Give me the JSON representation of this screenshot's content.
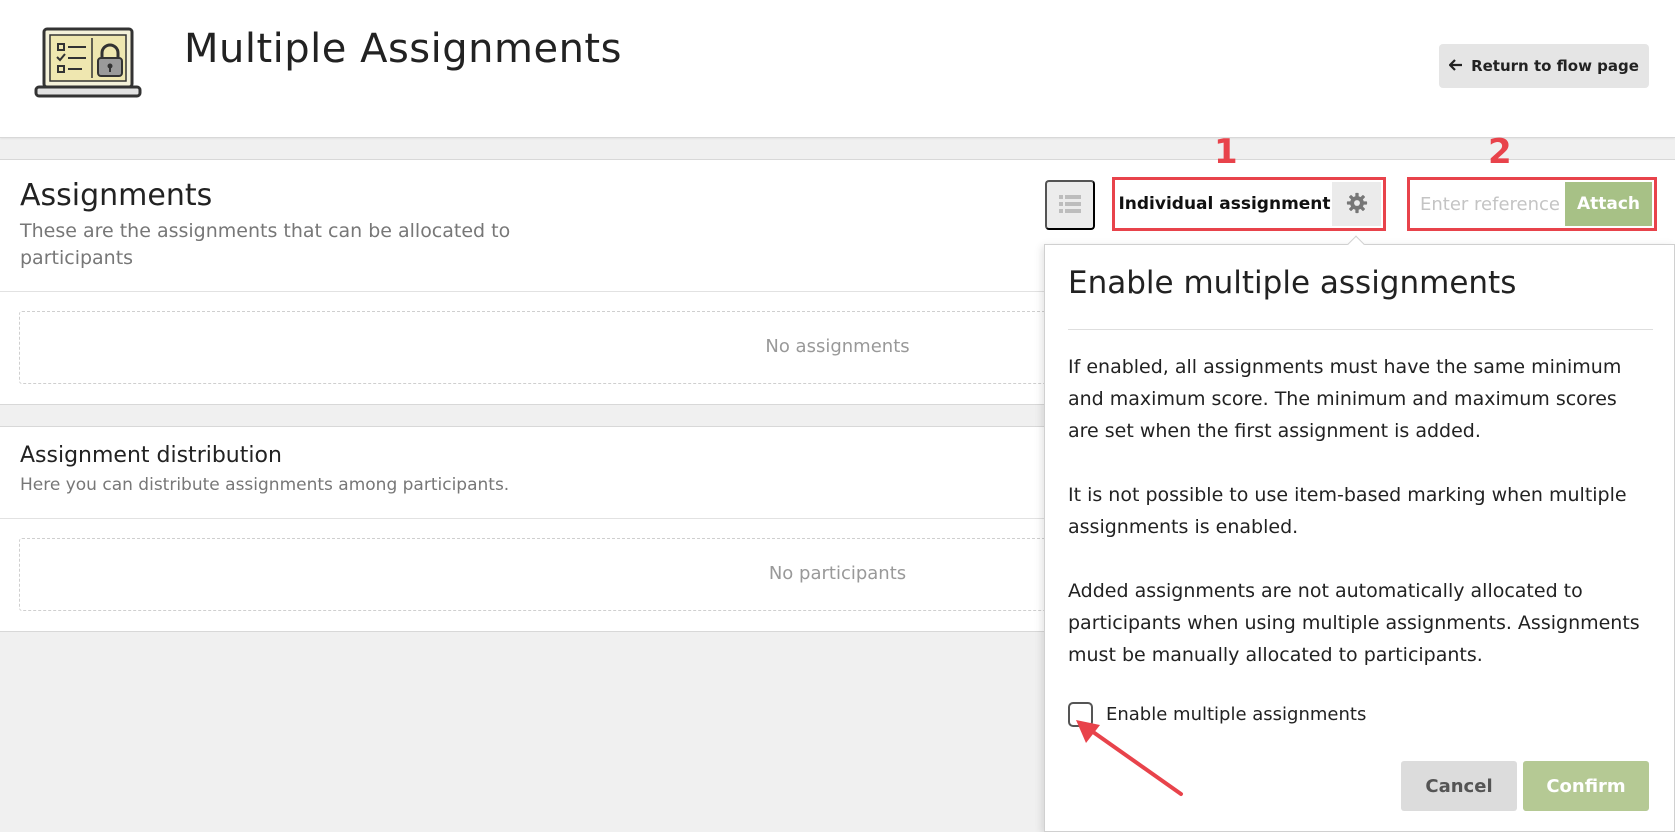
{
  "header": {
    "title": "Multiple Assignments",
    "return_label": "Return to flow page",
    "logo_icon": "laptop-checklist-lock-icon"
  },
  "assignments": {
    "title": "Assignments",
    "subtitle": "These are the assignments that can be allocated to participants",
    "empty_text": "No assignments"
  },
  "toolbar": {
    "list_icon": "list-icon",
    "assignment_type_label": "Individual assignment",
    "settings_icon": "gear-icon",
    "reference_placeholder": "Enter reference",
    "reference_value": "",
    "attach_label": "Attach"
  },
  "annotations": {
    "marker_1": "1",
    "marker_2": "2",
    "highlight_color": "#e8434b"
  },
  "distribution": {
    "title": "Assignment distribution",
    "subtitle": "Here you can distribute assignments among participants.",
    "empty_text": "No participants"
  },
  "popover": {
    "title": "Enable multiple assignments",
    "paragraph_1": "If enabled, all assignments must have the same minimum and maximum score. The minimum and maximum scores are set when the first assignment is added.",
    "paragraph_2": "It is not possible to use item-based marking when multiple assignments is enabled.",
    "paragraph_3": "Added assignments are not automatically allocated to participants when using multiple assignments. Assignments must be manually allocated to participants.",
    "checkbox_label": "Enable multiple assignments",
    "checkbox_checked": false,
    "cancel_label": "Cancel",
    "confirm_label": "Confirm"
  },
  "colors": {
    "accent_green": "#a7c186",
    "background": "#f0f0f0",
    "annotation_red": "#e8434b"
  }
}
